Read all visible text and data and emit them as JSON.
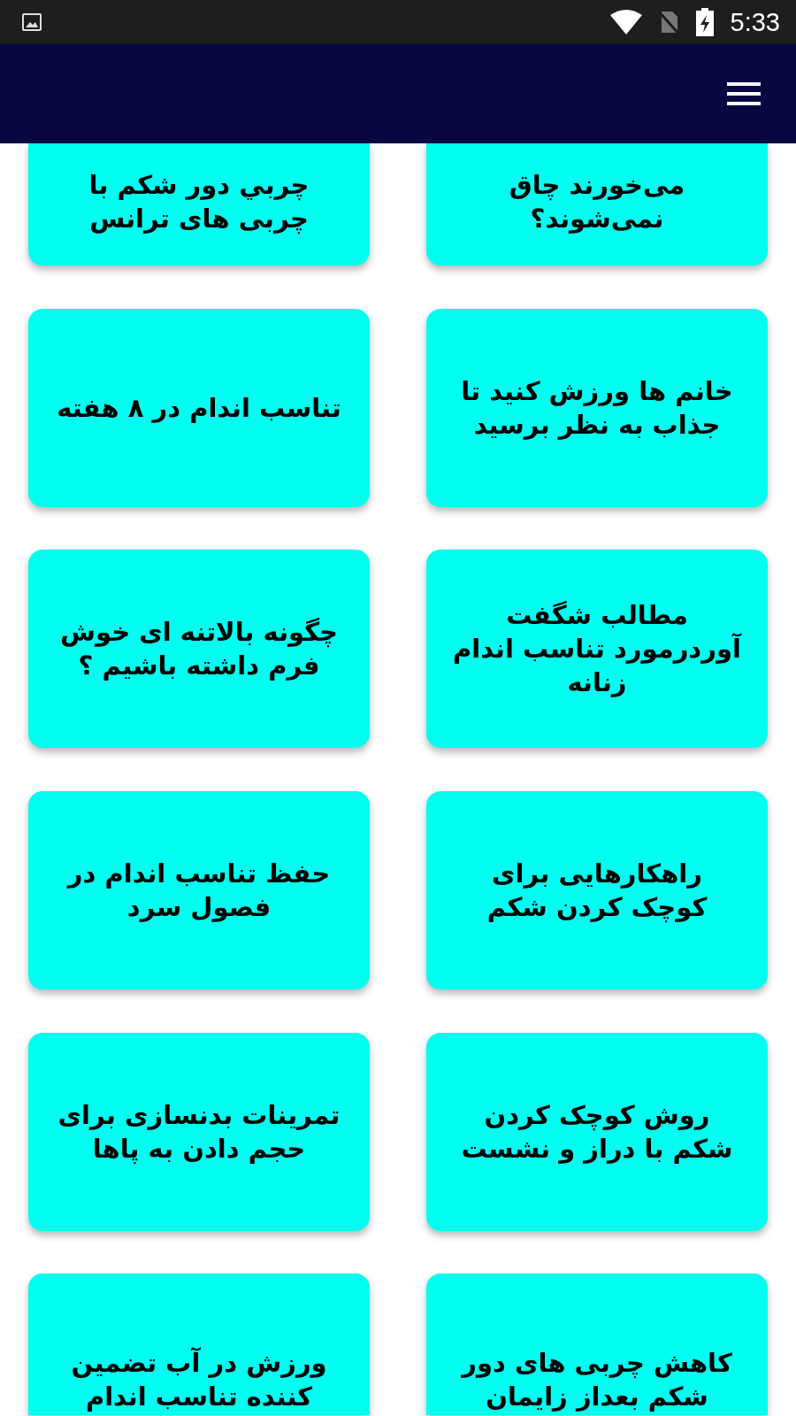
{
  "status_bar": {
    "time": "5:33"
  },
  "cards": [
    {
      "title": "می‌خورند چاق نمی‌شوند؟"
    },
    {
      "title": "چربي دور شکم با چربی های ترانس"
    },
    {
      "title": "خانم ها ورزش کنید تا جذاب به نظر برسید"
    },
    {
      "title": "تناسب اندام در ۸ هفته"
    },
    {
      "title": "مطالب شگفت آوردرمورد تناسب اندام زنانه"
    },
    {
      "title": "چگونه بالاتنه ای خوش فرم داشته باشیم ؟"
    },
    {
      "title": "راهکارهایی برای کوچک کردن شکم"
    },
    {
      "title": "حفظ تناسب اندام در فصول سرد"
    },
    {
      "title": "روش کوچک کردن شکم با دراز و نشست"
    },
    {
      "title": "تمرینات بدنسازی برای حجم دادن به پاها"
    },
    {
      "title": "کاهش چربی های دور شکم بعداز زایمان"
    },
    {
      "title": "ورزش در آب تضمین کننده تناسب اندام"
    }
  ]
}
